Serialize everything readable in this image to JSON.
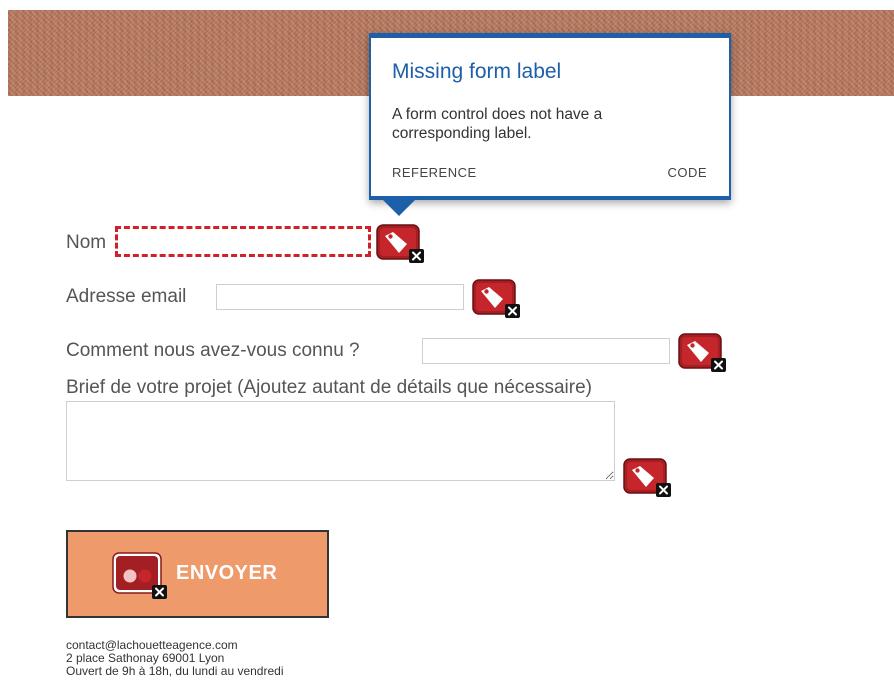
{
  "popup": {
    "title": "Missing form label",
    "description": "A form control does not have a corresponding label.",
    "reference_label": "REFERENCE",
    "code_label": "CODE"
  },
  "form": {
    "name_label": "Nom",
    "email_label": "Adresse email",
    "source_label": "Comment nous avez-vous connu ?",
    "brief_label": "Brief de votre projet (Ajoutez autant de détails que nécessaire)",
    "submit_label": "ENVOYER"
  },
  "footer": {
    "email": "contact@lachouetteagence.com",
    "address": "2 place Sathonay 69001 Lyon",
    "hours": "Ouvert de 9h à 18h, du lundi au vendredi"
  },
  "icons": {
    "label_error_icon": "tag-error-icon",
    "button_error_icon": "button-error-icon"
  },
  "colors": {
    "popup_accent": "#1d5fa8",
    "error_red": "#a31f23",
    "button_bg": "#ee9a6b",
    "banner_bg": "#b9775a"
  }
}
